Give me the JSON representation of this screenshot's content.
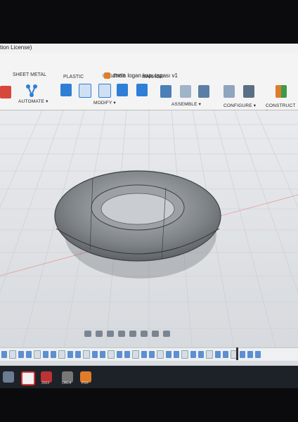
{
  "window": {
    "license_text": "tion License)",
    "doc_title": "dacia logan kapı tapası v1"
  },
  "tabs": [
    "SHEET METAL",
    "PLASTIC",
    "UTILITIES",
    "MANAGE"
  ],
  "groups": [
    "AUTOMATE ▾",
    "MODIFY ▾",
    "ASSEMBLE ▾",
    "CONFIGURE ▾",
    "CONSTRUCT ▾"
  ],
  "taskbar": {
    "label1": "2022",
    "label2": "ORL4",
    "label3": "FSX"
  },
  "colors": {
    "accent": "#2f7fd6",
    "model": "#8d9196",
    "grid": "#c7cbd1"
  }
}
